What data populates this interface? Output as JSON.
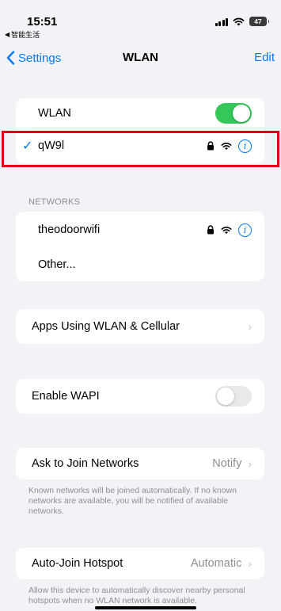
{
  "status": {
    "time": "15:51",
    "back_app": "智能生活",
    "battery": "47"
  },
  "nav": {
    "back_label": "Settings",
    "title": "WLAN",
    "edit_label": "Edit"
  },
  "wlan": {
    "label": "WLAN",
    "enabled": true
  },
  "connected": {
    "name": "qW9l"
  },
  "networks": {
    "header": "NETWORKS",
    "items": [
      {
        "name": "theodoorwifi"
      },
      {
        "name": "Other..."
      }
    ]
  },
  "apps_using": {
    "label": "Apps Using WLAN & Cellular"
  },
  "wapi": {
    "label": "Enable WAPI",
    "enabled": false
  },
  "ask_join": {
    "label": "Ask to Join Networks",
    "value": "Notify",
    "footer": "Known networks will be joined automatically. If no known networks are available, you will be notified of available networks."
  },
  "auto_join": {
    "label": "Auto-Join Hotspot",
    "value": "Automatic",
    "footer": "Allow this device to automatically discover nearby personal hotspots when no WLAN network is available."
  },
  "colors": {
    "accent": "#007aff",
    "toggle_on": "#34c759",
    "highlight": "#e60012"
  }
}
